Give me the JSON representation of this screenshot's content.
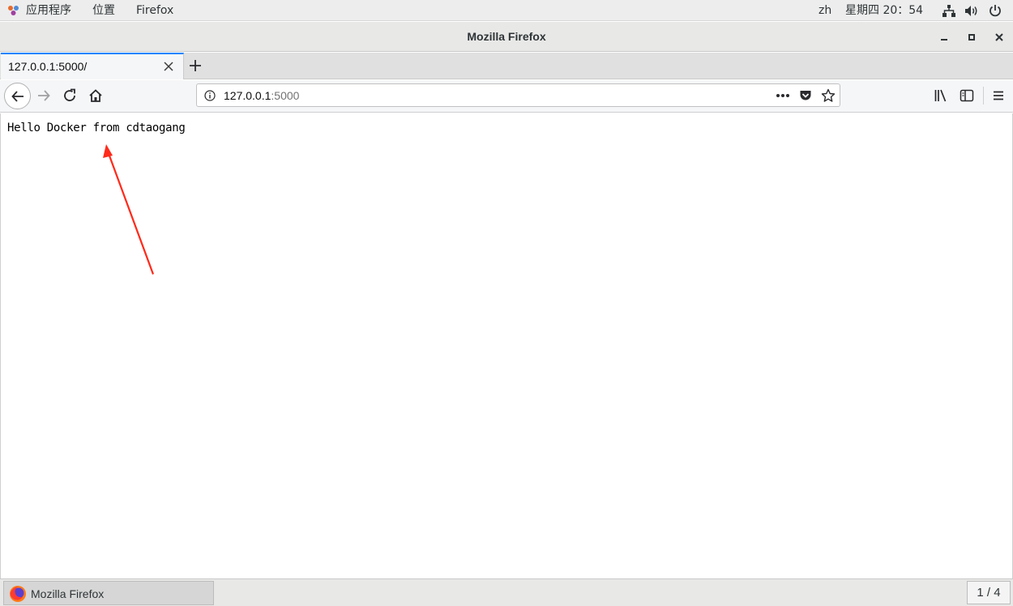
{
  "topbar": {
    "applications": "应用程序",
    "places": "位置",
    "active_app": "Firefox",
    "input_method": "zh",
    "clock": "星期四 20：54"
  },
  "window": {
    "title": "Mozilla Firefox"
  },
  "tabs": [
    {
      "label": "127.0.0.1:5000/",
      "active": true
    }
  ],
  "urlbar": {
    "host": "127.0.0.1",
    "port": ":5000"
  },
  "page": {
    "body_text": "Hello Docker from cdtaogang"
  },
  "annotation": {
    "color": "#ff2a1a"
  },
  "taskbar": {
    "window_label": "Mozilla Firefox",
    "workspace": "1 / 4"
  },
  "colors": {
    "accent": "#0a84ff"
  }
}
